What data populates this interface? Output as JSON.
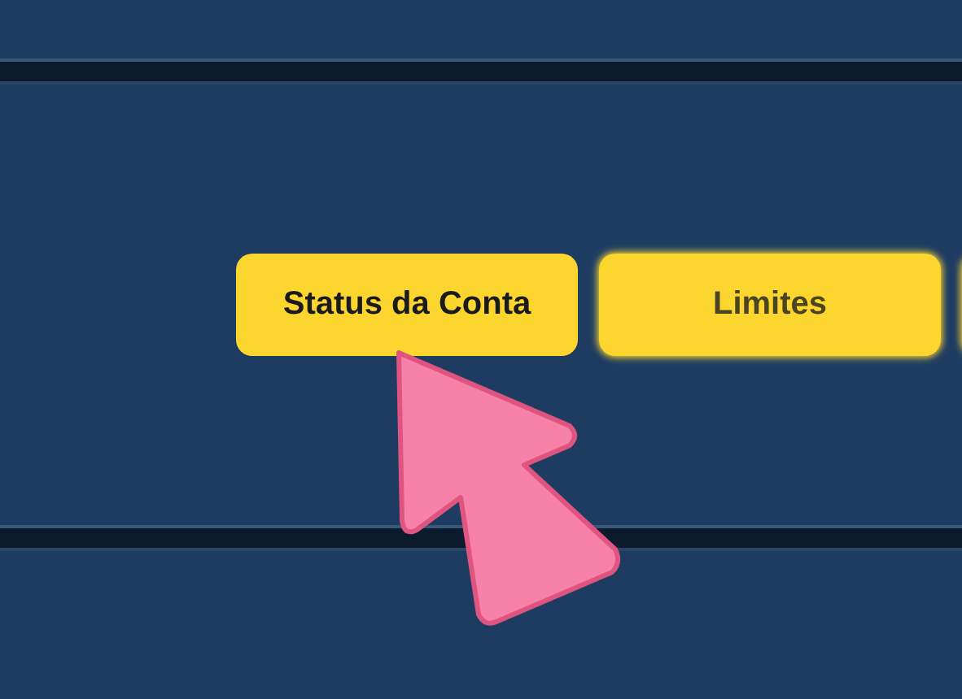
{
  "buttons": [
    {
      "label": "Status da Conta",
      "selected": true
    },
    {
      "label": "Limites",
      "selected": false
    }
  ]
}
